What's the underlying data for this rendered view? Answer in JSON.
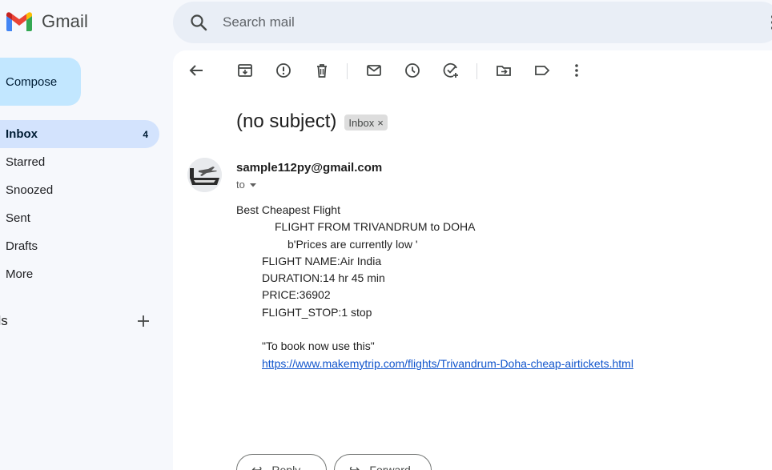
{
  "app": {
    "name": "Gmail"
  },
  "search": {
    "placeholder": "Search mail"
  },
  "sidebar": {
    "compose_label": "Compose",
    "items": [
      {
        "label": "Inbox",
        "count": "4",
        "active": true
      },
      {
        "label": "Starred"
      },
      {
        "label": "Snoozed"
      },
      {
        "label": "Sent"
      },
      {
        "label": "Drafts"
      },
      {
        "label": "More"
      }
    ],
    "labels_header": "els"
  },
  "toolbar": {
    "icons": [
      "back-arrow-icon",
      "archive-icon",
      "report-spam-icon",
      "delete-icon",
      "mark-unread-icon",
      "snooze-icon",
      "add-to-tasks-icon",
      "move-to-icon",
      "label-icon",
      "more-options-icon"
    ]
  },
  "email": {
    "subject": "(no subject)",
    "label_chip": "Inbox",
    "chip_close": "×",
    "sender": "sample112py@gmail.com",
    "to": "to",
    "body": {
      "line1": "Best Cheapest Flight",
      "line2": "FLIGHT FROM TRIVANDRUM to DOHA",
      "line3": "b'Prices are currently low '",
      "line4": "FLIGHT NAME:Air India",
      "line5": "DURATION:14 hr 45 min",
      "line6": "PRICE:36902",
      "line7": "FLIGHT_STOP:1 stop",
      "line8": "\"To book now use this\"",
      "link": "https://www.makemytrip.com/flights/Trivandrum-Doha-cheap-airtickets.html"
    }
  },
  "actions": {
    "reply_label": "Reply",
    "forward_label": "Forward"
  },
  "colors": {
    "compose_bg": "#c2e7ff",
    "active_nav_bg": "#d3e3fd",
    "link": "#1155cc",
    "page_bg": "#f6f8fc"
  }
}
